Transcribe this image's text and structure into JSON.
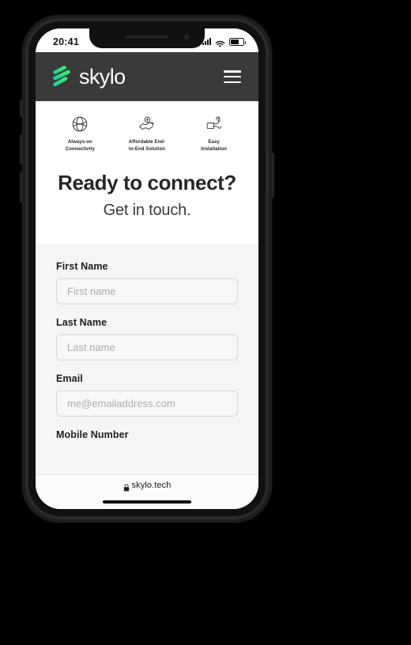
{
  "device": {
    "status_bar": {
      "time": "20:41",
      "icons": [
        "cellular-signal-icon",
        "wifi-icon",
        "battery-icon"
      ]
    },
    "home_indicator": "home-indicator"
  },
  "browser": {
    "lock_icon": "lock-icon",
    "url": "skylo.tech"
  },
  "site_header": {
    "brand_name": "skylo",
    "brand_mark": "skylo-logo-icon",
    "menu_icon": "hamburger-menu-icon",
    "background_color": "#3a3a3a",
    "accent_color": "#2ee07a"
  },
  "features": [
    {
      "icon": "globe-connectivity-icon",
      "label": "Always-on\nConnectivity"
    },
    {
      "icon": "handshake-money-icon",
      "label": "Affordable End-\nto-End Solution"
    },
    {
      "icon": "hand-install-icon",
      "label": "Easy\nInstallation"
    }
  ],
  "hero": {
    "title": "Ready to connect?",
    "subtitle": "Get in touch."
  },
  "form": {
    "fields": [
      {
        "label": "First Name",
        "placeholder": "First name",
        "value": ""
      },
      {
        "label": "Last Name",
        "placeholder": "Last name",
        "value": ""
      },
      {
        "label": "Email",
        "placeholder": "me@emailaddress.com",
        "value": ""
      },
      {
        "label": "Mobile Number",
        "placeholder": "",
        "value": ""
      }
    ]
  }
}
